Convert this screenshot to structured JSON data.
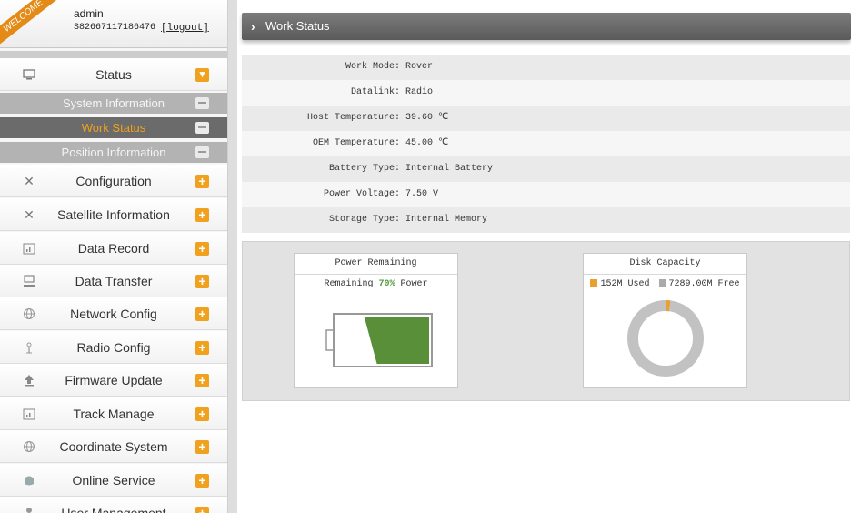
{
  "user": {
    "welcome": "WELCOME",
    "name": "admin",
    "serial": "S82667117186476",
    "logout": "[logout]"
  },
  "sidebar": {
    "items": [
      {
        "icon": "monitor-icon",
        "label": "Status",
        "toggle": "▾"
      },
      {
        "icon": "tools-icon",
        "label": "Configuration",
        "toggle": "+"
      },
      {
        "icon": "satellite-icon",
        "label": "Satellite Information",
        "toggle": "+"
      },
      {
        "icon": "calendar-chart-icon",
        "label": "Data Record",
        "toggle": "+"
      },
      {
        "icon": "network-computer-icon",
        "label": "Data Transfer",
        "toggle": "+"
      },
      {
        "icon": "globe-icon",
        "label": "Network Config",
        "toggle": "+"
      },
      {
        "icon": "antenna-icon",
        "label": "Radio Config",
        "toggle": "+"
      },
      {
        "icon": "upload-icon",
        "label": "Firmware Update",
        "toggle": "+"
      },
      {
        "icon": "calendar-chart-icon",
        "label": "Track Manage",
        "toggle": "+"
      },
      {
        "icon": "globe-icon",
        "label": "Coordinate System",
        "toggle": "+"
      },
      {
        "icon": "service-icon",
        "label": "Online Service",
        "toggle": "+"
      },
      {
        "icon": "user-icon",
        "label": "User Management",
        "toggle": "+"
      }
    ],
    "status_sub": [
      {
        "label": "System Information"
      },
      {
        "label": "Work Status",
        "active": true
      },
      {
        "label": "Position Information"
      }
    ]
  },
  "main": {
    "title": "Work Status",
    "rows": [
      {
        "label": "Work Mode:",
        "value": "Rover"
      },
      {
        "label": "Datalink:",
        "value": "Radio"
      },
      {
        "label": "Host Temperature:",
        "value": "39.60 ℃"
      },
      {
        "label": "OEM Temperature:",
        "value": "45.00 ℃"
      },
      {
        "label": "Battery Type:",
        "value": "Internal Battery"
      },
      {
        "label": "Power Voltage:",
        "value": "7.50 V"
      },
      {
        "label": "Storage Type:",
        "value": "Internal Memory"
      }
    ],
    "power": {
      "title": "Power Remaining",
      "prefix": "Remaining",
      "percent_text": "70%",
      "suffix": "Power",
      "fraction": 0.7
    },
    "disk": {
      "title": "Disk Capacity",
      "used_label": "152M Used",
      "free_label": "7289.00M Free",
      "used": 152,
      "free": 7289.0
    }
  },
  "colors": {
    "accent": "#f0a21e",
    "battery_fill": "#5a8f3a",
    "disk_free": "#c2c2c2",
    "disk_used": "#e8a030"
  }
}
